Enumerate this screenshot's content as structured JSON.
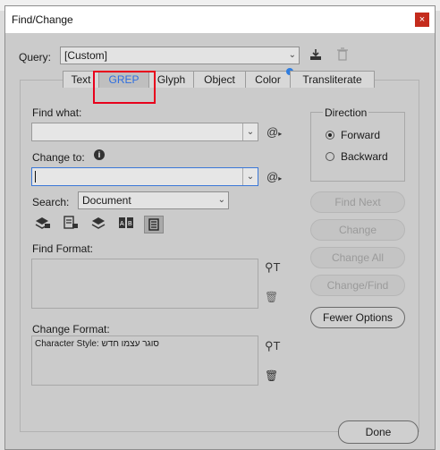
{
  "window": {
    "title": "Find/Change",
    "close_label": "×"
  },
  "query": {
    "label": "Query:",
    "value": "[Custom]"
  },
  "tabs": [
    {
      "label": "Text",
      "active": false
    },
    {
      "label": "GREP",
      "active": true
    },
    {
      "label": "Glyph",
      "active": false
    },
    {
      "label": "Object",
      "active": false
    },
    {
      "label": "Color",
      "active": false,
      "badge": true
    },
    {
      "label": "Transliterate",
      "active": false
    }
  ],
  "find_what": {
    "label": "Find what:",
    "value": ""
  },
  "change_to": {
    "label": "Change to:",
    "value": "",
    "info_icon": "i"
  },
  "search": {
    "label": "Search:",
    "value": "Document"
  },
  "find_format": {
    "label": "Find Format:",
    "value": ""
  },
  "change_format": {
    "label": "Change Format:",
    "value": "Character Style: סוגר עצמו חדש"
  },
  "direction": {
    "label": "Direction",
    "options": [
      "Forward",
      "Backward"
    ],
    "selected": "Forward"
  },
  "buttons": {
    "find_next": "Find Next",
    "change": "Change",
    "change_all": "Change All",
    "change_find": "Change/Find",
    "fewer_options": "Fewer Options",
    "done": "Done"
  },
  "colors": {
    "highlight": "#e8001c",
    "accent": "#2f7de0"
  }
}
